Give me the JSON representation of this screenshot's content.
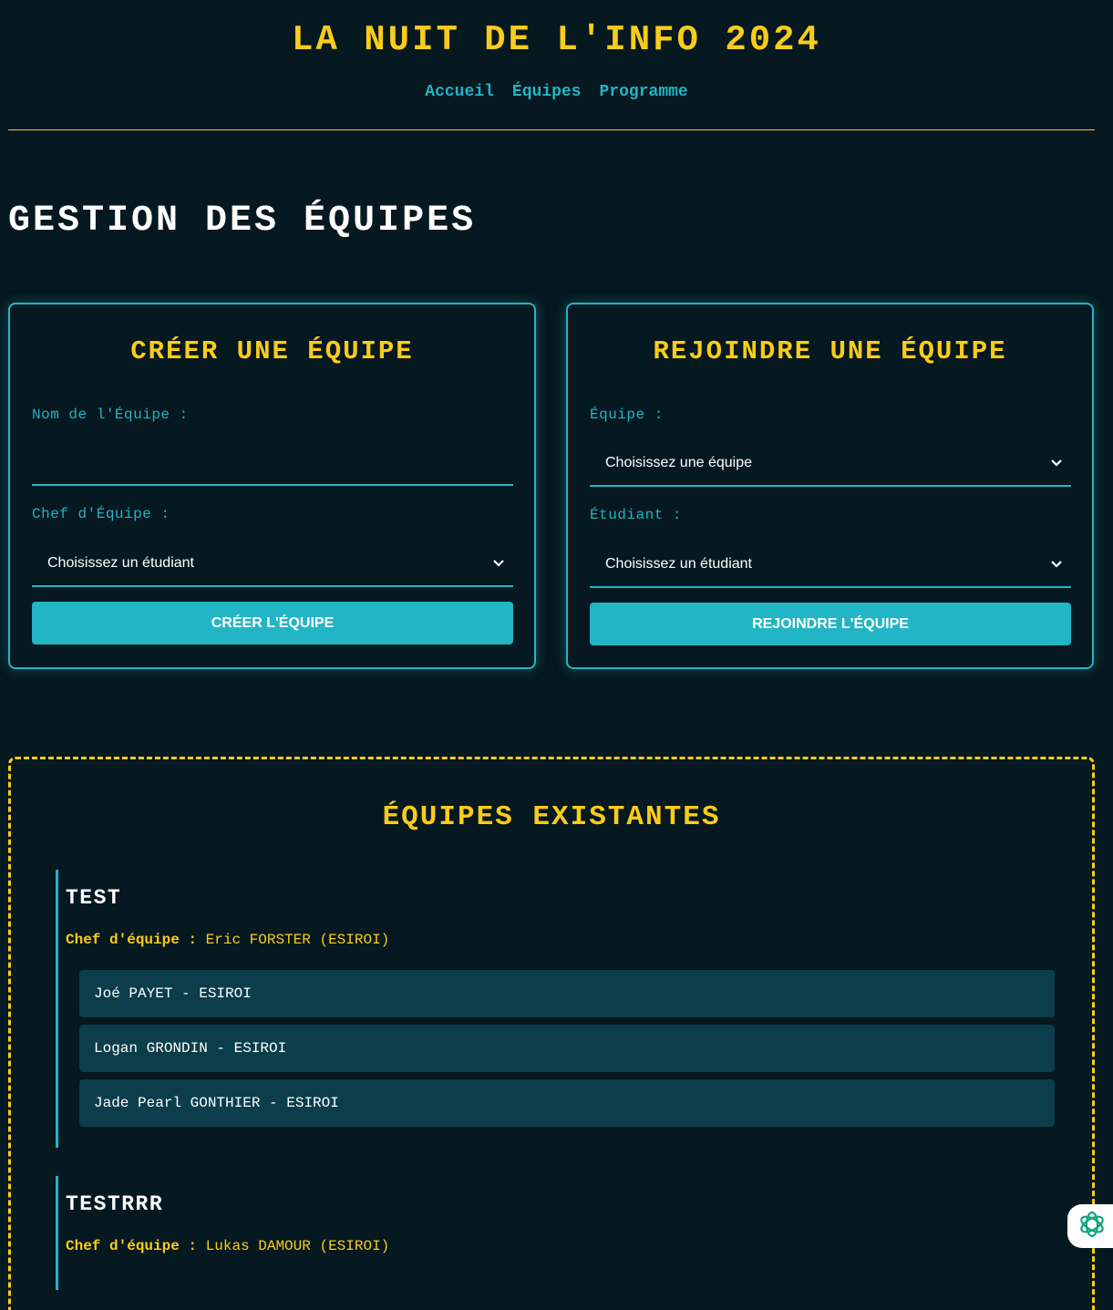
{
  "site": {
    "title": "LA NUIT DE L'INFO 2024",
    "nav": [
      "Accueil",
      "Équipes",
      "Programme"
    ]
  },
  "page": {
    "title": "GESTION DES ÉQUIPES"
  },
  "create_team": {
    "title": "CRÉER UNE ÉQUIPE",
    "name_label": "Nom de l'Équipe :",
    "name_value": "",
    "leader_label": "Chef d'Équipe :",
    "leader_selected": "Choisissez un étudiant",
    "submit_label": "CRÉER L'ÉQUIPE"
  },
  "join_team": {
    "title": "REJOINDRE UNE ÉQUIPE",
    "team_label": "Équipe :",
    "team_selected": "Choisissez une équipe",
    "student_label": "Étudiant :",
    "student_selected": "Choisissez un étudiant",
    "submit_label": "REJOINDRE L'ÉQUIPE"
  },
  "existing": {
    "title": "ÉQUIPES EXISTANTES",
    "leader_prefix": "Chef d'équipe",
    "teams": [
      {
        "name": "TEST",
        "leader": "Eric FORSTER (ESIROI)",
        "members": [
          "Joé PAYET - ESIROI",
          "Logan GRONDIN - ESIROI",
          "Jade Pearl GONTHIER - ESIROI"
        ]
      },
      {
        "name": "TESTRRR",
        "leader": "Lukas DAMOUR (ESIROI)",
        "members": []
      }
    ]
  },
  "colors": {
    "background": "#061820",
    "accent": "#f9cc1a",
    "cyan": "#22b5c5",
    "member_bg": "#0b3d4a"
  },
  "icons": {
    "assistant": "openai-knot-icon",
    "chevron": "chevron-down-icon"
  }
}
